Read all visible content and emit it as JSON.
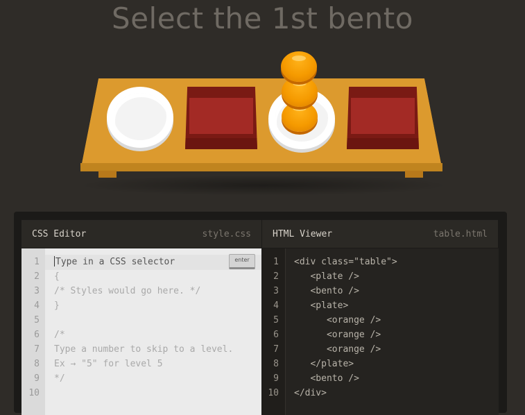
{
  "level": {
    "instruction": "Select the 1st bento"
  },
  "css_editor": {
    "title": "CSS Editor",
    "filename": "style.css",
    "input_placeholder": "Type in a CSS selector",
    "enter_label": "enter",
    "line_numbers": [
      "1",
      "2",
      "3",
      "4",
      "5",
      "6",
      "7",
      "8",
      "9",
      "10"
    ],
    "lines": [
      "Type in a CSS selector",
      "{",
      "/* Styles would go here. */",
      "}",
      "",
      "/*",
      "Type a number to skip to a level.",
      "Ex → \"5\" for level 5",
      "*/",
      ""
    ]
  },
  "html_viewer": {
    "title": "HTML Viewer",
    "filename": "table.html",
    "line_numbers": [
      "1",
      "2",
      "3",
      "4",
      "5",
      "6",
      "7",
      "8",
      "9",
      "10"
    ],
    "lines": [
      "<div class=\"table\">",
      "   <plate />",
      "   <bento />",
      "   <plate>",
      "      <orange />",
      "      <orange />",
      "      <orange />",
      "   </plate>",
      "   <bento />",
      "</div>"
    ]
  },
  "colors": {
    "background": "#2f2c28",
    "table": "#dc9a2e",
    "bento": "#a32a25",
    "orange": "#f59a00",
    "plate": "#ffffff"
  }
}
